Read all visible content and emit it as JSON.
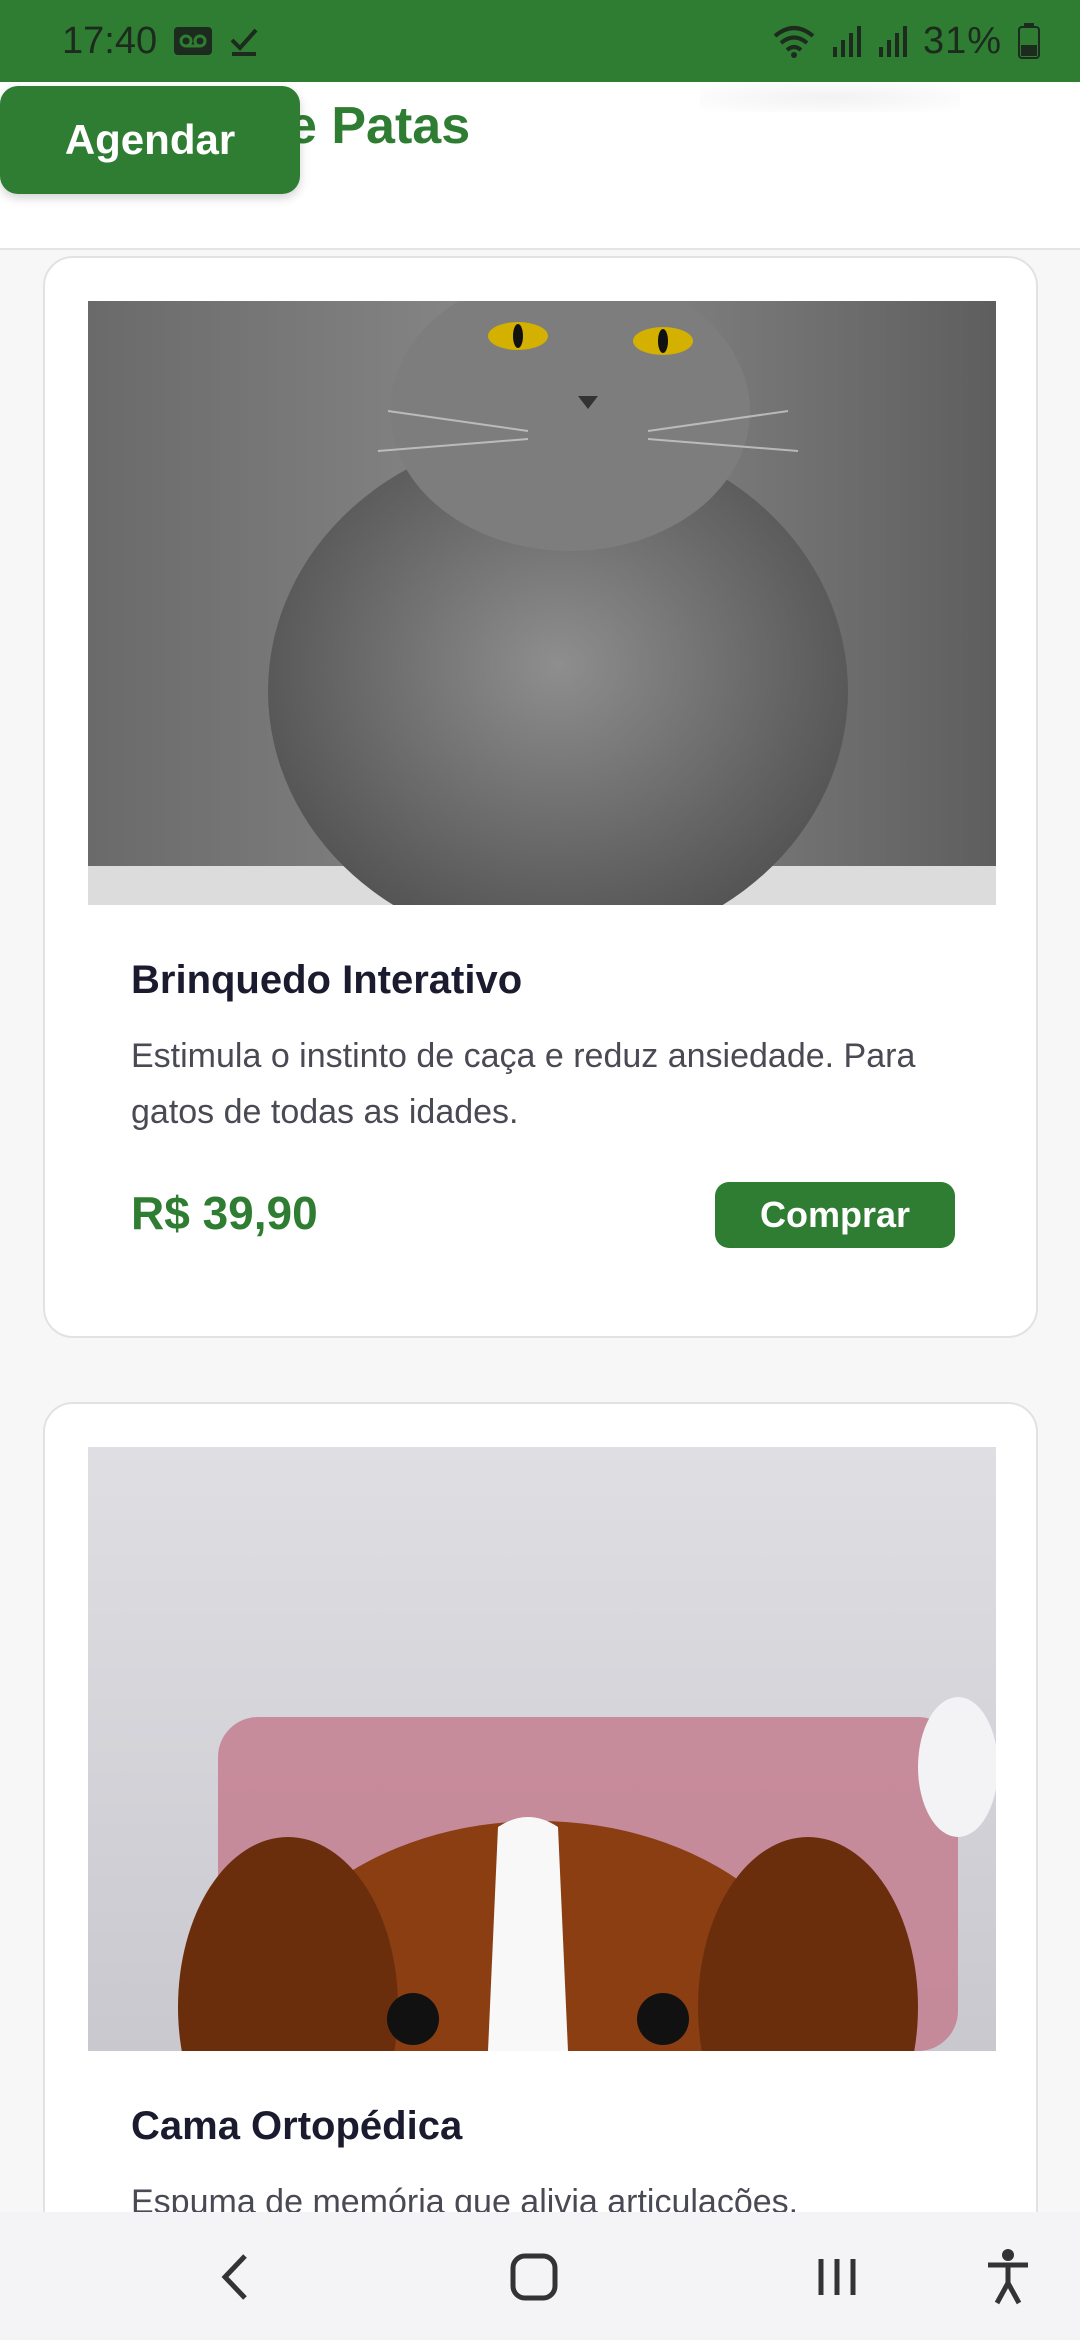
{
  "status_bar": {
    "time": "17:40",
    "battery_percent": "31%",
    "icons": [
      "voicemail-icon",
      "check-icon",
      "wifi-icon",
      "signal-icon",
      "signal-icon",
      "battery-icon"
    ]
  },
  "header": {
    "brand_name": "Amor de Patas",
    "brand_icon": "location-pin-icon",
    "schedule_button_label": "Agendar"
  },
  "products": [
    {
      "name": "Brinquedo Interativo",
      "description": "Estimula o instinto de caça e reduz ansiedade. Para gatos de todas as idades.",
      "price": "R$ 39,90",
      "buy_label": "Comprar",
      "image_subject": "gray-cat-photo"
    },
    {
      "name": "Cama Ortopédica",
      "description": "Espuma de memória que alivia articulações.",
      "image_subject": "puppy-photo"
    }
  ],
  "navigation": {
    "icons": [
      "back-icon",
      "home-icon",
      "recents-icon",
      "accessibility-icon"
    ]
  },
  "colors": {
    "brand_green": "#2e7d32",
    "card_border": "#e2e2e2",
    "text_dark": "#1b1b2f",
    "text_muted": "#4a4a55"
  }
}
